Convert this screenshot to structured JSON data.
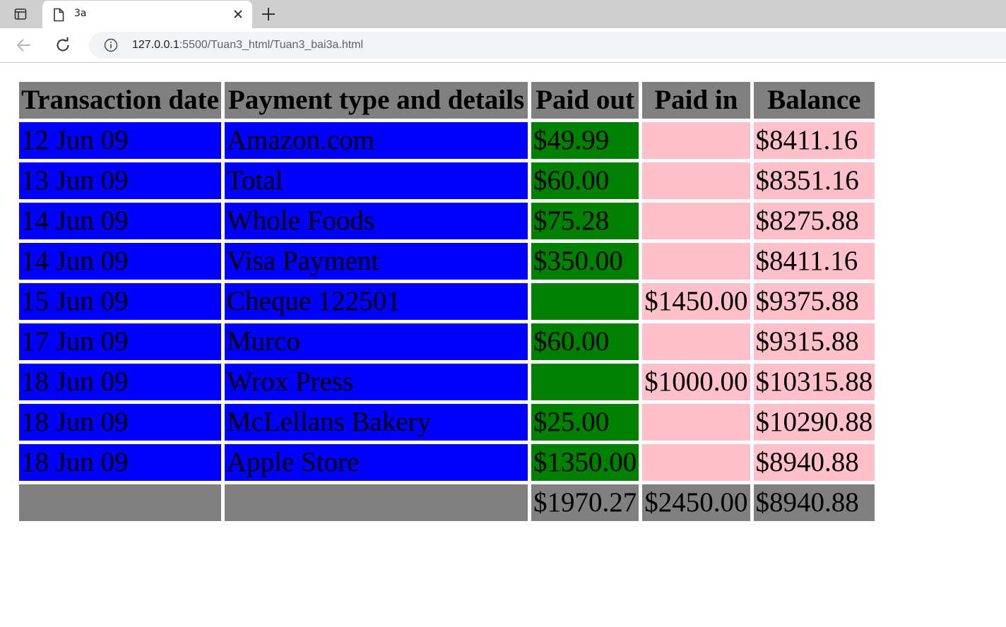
{
  "browser": {
    "tab_title": "3a",
    "url_host": "127.0.0.1",
    "url_path": ":5500/Tuan3_html/Tuan3_bai3a.html"
  },
  "table": {
    "headers": [
      "Transaction date",
      "Payment type and details",
      "Paid out",
      "Paid in",
      "Balance"
    ],
    "rows": [
      {
        "date": "12 Jun 09",
        "details": "Amazon.com",
        "paid_out": "$49.99",
        "paid_in": "",
        "balance": "$8411.16"
      },
      {
        "date": "13 Jun 09",
        "details": "Total",
        "paid_out": "$60.00",
        "paid_in": "",
        "balance": "$8351.16"
      },
      {
        "date": "14 Jun 09",
        "details": "Whole Foods",
        "paid_out": "$75.28",
        "paid_in": "",
        "balance": "$8275.88"
      },
      {
        "date": "14 Jun 09",
        "details": "Visa Payment",
        "paid_out": "$350.00",
        "paid_in": "",
        "balance": "$8411.16"
      },
      {
        "date": "15 Jun 09",
        "details": "Cheque 122501",
        "paid_out": "",
        "paid_in": "$1450.00",
        "balance": "$9375.88"
      },
      {
        "date": "17 Jun 09",
        "details": "Murco",
        "paid_out": "$60.00",
        "paid_in": "",
        "balance": "$9315.88"
      },
      {
        "date": "18 Jun 09",
        "details": "Wrox Press",
        "paid_out": "",
        "paid_in": "$1000.00",
        "balance": "$10315.88"
      },
      {
        "date": "18 Jun 09",
        "details": "McLellans Bakery",
        "paid_out": "$25.00",
        "paid_in": "",
        "balance": "$10290.88"
      },
      {
        "date": "18 Jun 09",
        "details": "Apple Store",
        "paid_out": "$1350.00",
        "paid_in": "",
        "balance": "$8940.88"
      }
    ],
    "totals": {
      "date": "",
      "details": "",
      "paid_out": "$1970.27",
      "paid_in": "$2450.00",
      "balance": "$8940.88"
    }
  },
  "colors": {
    "header_bg": "#808080",
    "date_details_bg": "#0000ff",
    "paid_out_bg": "#008000",
    "paid_in_balance_bg": "#ffc0cb"
  },
  "icons": [
    "tab-actions-icon",
    "page-icon",
    "close-icon",
    "new-tab-icon",
    "back-icon",
    "reload-icon",
    "info-icon"
  ]
}
